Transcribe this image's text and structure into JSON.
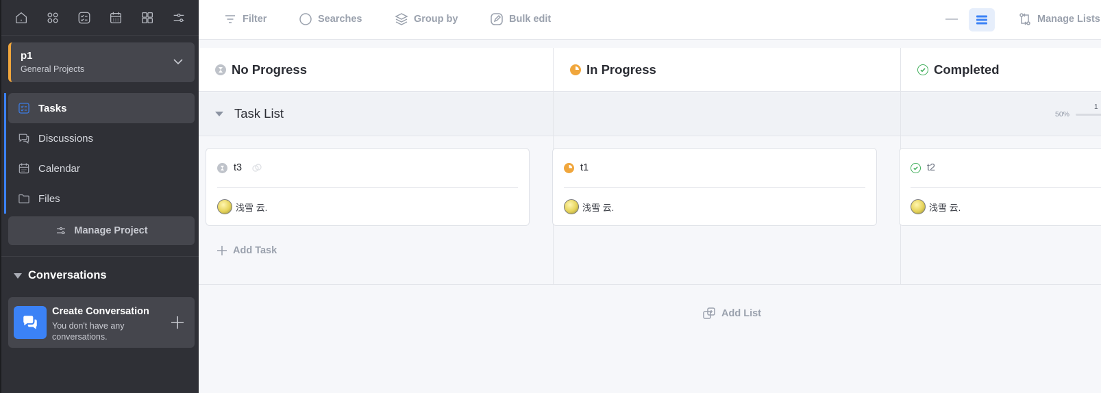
{
  "sidebar": {
    "project": {
      "name": "p1",
      "category": "General Projects"
    },
    "nav": [
      {
        "label": "Tasks",
        "icon": "tasks-icon",
        "active": true
      },
      {
        "label": "Discussions",
        "icon": "discussions-icon"
      },
      {
        "label": "Calendar",
        "icon": "calendar-icon"
      },
      {
        "label": "Files",
        "icon": "folder-icon"
      }
    ],
    "manage_label": "Manage Project",
    "conversations": {
      "heading": "Conversations",
      "create_title": "Create Conversation",
      "create_sub": "You don't have any conversations."
    }
  },
  "toolbar": {
    "filter": "Filter",
    "searches": "Searches",
    "group_by": "Group by",
    "bulk_edit": "Bulk edit",
    "manage_lists": "Manage Lists"
  },
  "columns": [
    {
      "label": "No Progress",
      "status_color": "#bfc3ca"
    },
    {
      "label": "In Progress",
      "status_color": "#f0a63c"
    },
    {
      "label": "Completed",
      "status_color": "#3fae5a"
    }
  ],
  "list": {
    "title": "Task List",
    "progress_percent": "50%",
    "count": "1",
    "add_task": "Add Task",
    "cards": [
      {
        "title": "t3",
        "assignee": "浅雪 云."
      },
      {
        "title": "t1",
        "assignee": "浅雪 云."
      },
      {
        "title": "t2",
        "assignee": "浅雪 云."
      }
    ]
  },
  "add_list": "Add List"
}
